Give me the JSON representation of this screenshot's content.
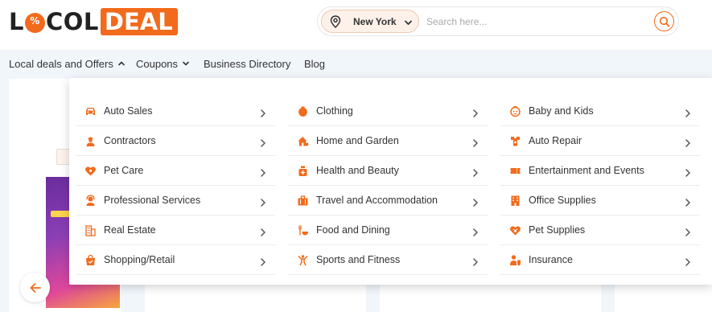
{
  "logo": {
    "part1": "LOCOL",
    "part2": "DEAL"
  },
  "location": {
    "city": "New York"
  },
  "search": {
    "placeholder": "Search here..."
  },
  "nav": {
    "items": [
      {
        "label": "Local deals and Offers",
        "has_caret": true,
        "caret": "up"
      },
      {
        "label": "Coupons",
        "has_caret": true,
        "caret": "down"
      },
      {
        "label": "Business Directory",
        "has_caret": false
      },
      {
        "label": "Blog",
        "has_caret": false
      }
    ]
  },
  "menu": {
    "columns": [
      [
        {
          "label": "Auto Sales",
          "icon": "car-icon"
        },
        {
          "label": "Contractors",
          "icon": "worker-icon"
        },
        {
          "label": "Pet Care",
          "icon": "pet-heart-icon"
        },
        {
          "label": "Professional Services",
          "icon": "support-agent-icon"
        },
        {
          "label": "Real Estate",
          "icon": "building-icon"
        },
        {
          "label": "Shopping/Retail",
          "icon": "shopping-bag-icon"
        }
      ],
      [
        {
          "label": "Clothing",
          "icon": "clothing-icon"
        },
        {
          "label": "Home and Garden",
          "icon": "house-icon"
        },
        {
          "label": "Health and Beauty",
          "icon": "beauty-jar-icon"
        },
        {
          "label": "Travel and Accommodation",
          "icon": "luggage-icon"
        },
        {
          "label": "Food and Dining",
          "icon": "food-icon"
        },
        {
          "label": "Sports and Fitness",
          "icon": "fitness-icon"
        }
      ],
      [
        {
          "label": "Baby and Kids",
          "icon": "baby-icon"
        },
        {
          "label": "Auto Repair",
          "icon": "auto-repair-icon"
        },
        {
          "label": "Entertainment and Events",
          "icon": "ticket-icon"
        },
        {
          "label": "Office Supplies",
          "icon": "office-building-icon"
        },
        {
          "label": "Pet Supplies",
          "icon": "paw-icon"
        },
        {
          "label": "Insurance",
          "icon": "insurance-icon"
        }
      ]
    ]
  },
  "colors": {
    "accent": "#f26a1b",
    "nav_bg": "#f1f6fb",
    "text": "#333333"
  }
}
